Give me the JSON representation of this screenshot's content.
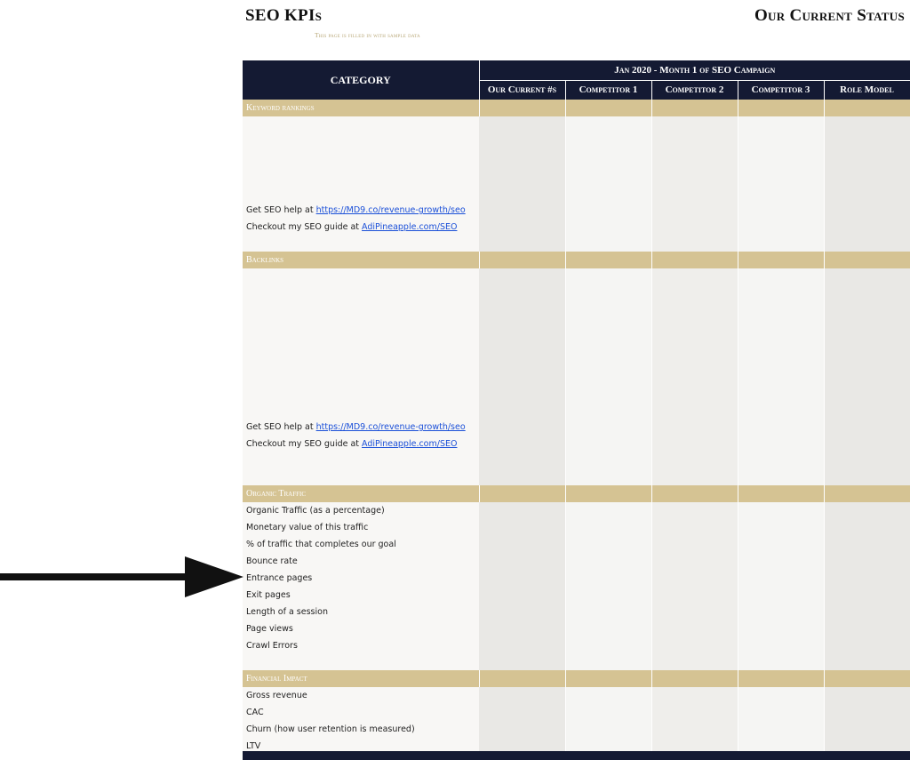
{
  "header": {
    "title_left": "SEO KPIs",
    "title_right": "Our Current Status",
    "subtitle": "This page is filled in with sample data"
  },
  "table": {
    "category_label": "CATEGORY",
    "period_label": "Jan 2020 - Month 1 of SEO Campaign",
    "columns": [
      "Our Current #s",
      "Competitor 1",
      "Competitor 2",
      "Competitor 3",
      "Role Model"
    ],
    "sections": {
      "keyword": {
        "title": "Keyword rankings",
        "help_prefix": "Get SEO help at ",
        "help_link": "https://MD9.co/revenue-growth/seo",
        "guide_prefix": "Checkout my SEO guide at ",
        "guide_link": "AdiPineapple.com/SEO"
      },
      "backlinks": {
        "title": "Backlinks",
        "help_prefix": "Get SEO help at ",
        "help_link": "https://MD9.co/revenue-growth/seo",
        "guide_prefix": "Checkout my SEO guide at ",
        "guide_link": "AdiPineapple.com/SEO"
      },
      "organic": {
        "title": "Organic Traffic",
        "rows": [
          "Organic Traffic (as a percentage)",
          "Monetary value of this traffic",
          "% of traffic that completes our goal",
          "Bounce rate",
          "Entrance pages",
          "Exit pages",
          "Length of a session",
          "Page views",
          "Crawl Errors"
        ]
      },
      "financial": {
        "title": "Financial Impact",
        "rows": [
          "Gross revenue",
          "CAC",
          "Churn (how user retention is measured)",
          "LTV"
        ]
      }
    }
  },
  "colors": {
    "header_navy": "#141a33",
    "section_gold": "#d5c393",
    "link_blue": "#1a4fd8"
  }
}
